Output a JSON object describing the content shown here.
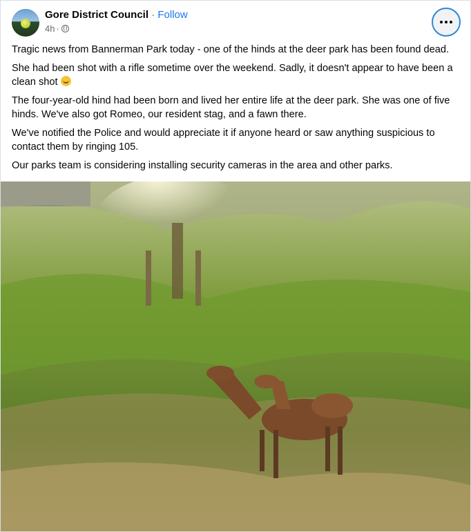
{
  "post": {
    "author": "Gore District Council",
    "separator": "·",
    "follow_label": "Follow",
    "timestamp": "4h",
    "audience_icon": "globe-icon",
    "more_icon": "more-options-icon",
    "paragraphs": [
      "Tragic news from Bannerman Park today - one of the hinds at the deer park has been found dead.",
      "She had been shot with a rifle sometime over the weekend. Sadly, it doesn't appear to have been a clean shot",
      "The four-year-old hind had been born and lived her entire life at the deer park. She was one of five hinds. We've also got Romeo, our resident stag, and a fawn there.",
      "We've notified the Police and would appreciate it if anyone heard or saw anything suspicious to contact them by ringing 105.",
      "Our parks team is considering installing security cameras in the area and other parks."
    ],
    "emoji": "crying-face-emoji"
  },
  "colors": {
    "link": "#1877f2",
    "secondary_text": "#65676b",
    "focus_ring": "#2d86d6"
  }
}
